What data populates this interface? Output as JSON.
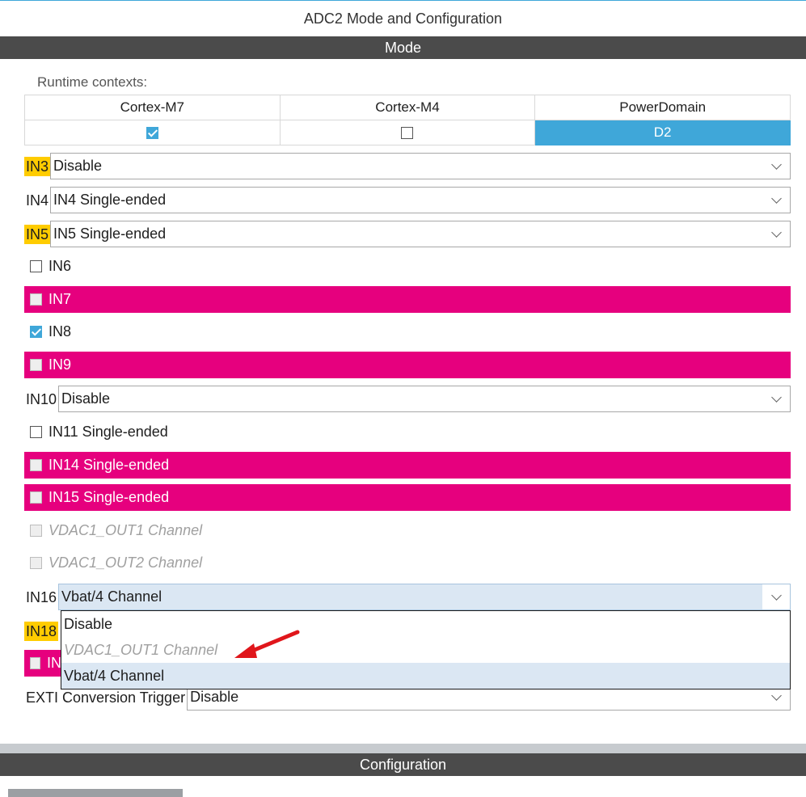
{
  "window": {
    "title": "ADC2 Mode and Configuration"
  },
  "sections": {
    "mode": "Mode",
    "configuration": "Configuration"
  },
  "runtime": {
    "label": "Runtime contexts:",
    "columns": [
      "Cortex-M7",
      "Cortex-M4",
      "PowerDomain"
    ],
    "cortex_m7_checked": true,
    "cortex_m4_checked": false,
    "power_domain": "D2"
  },
  "channels": {
    "in3": {
      "label": "IN3",
      "value": "Disable",
      "highlight": true
    },
    "in4": {
      "label": "IN4",
      "value": "IN4 Single-ended"
    },
    "in5": {
      "label": "IN5",
      "value": "IN5 Single-ended",
      "highlight": true
    },
    "in6": {
      "label": "IN6",
      "checked": false
    },
    "in7": {
      "label": "IN7",
      "checked": false,
      "conflict": true
    },
    "in8": {
      "label": "IN8",
      "checked": true
    },
    "in9": {
      "label": "IN9",
      "checked": false,
      "conflict": true
    },
    "in10": {
      "label": "IN10",
      "value": "Disable"
    },
    "in11": {
      "label": "IN11 Single-ended",
      "checked": false
    },
    "in14": {
      "label": "IN14 Single-ended",
      "checked": false,
      "conflict": true
    },
    "in15": {
      "label": "IN15 Single-ended",
      "checked": false,
      "conflict": true
    },
    "vdac1_out1": {
      "label": "VDAC1_OUT1 Channel",
      "disabled": true
    },
    "vdac1_out2": {
      "label": "VDAC1_OUT2 Channel",
      "disabled": true
    },
    "in16": {
      "label": "IN16",
      "value": "Vbat/4 Channel"
    },
    "in18": {
      "label": "IN18"
    },
    "in19_partial": {
      "label": "IN"
    },
    "exti": {
      "label": "EXTI Conversion Trigger",
      "value": "Disable"
    }
  },
  "dropdown_options": [
    {
      "label": "Disable",
      "state": "normal"
    },
    {
      "label": "VDAC1_OUT1 Channel",
      "state": "disabled"
    },
    {
      "label": "Vbat/4 Channel",
      "state": "selected"
    }
  ],
  "colors": {
    "accent": "#3fa7d9",
    "conflict": "#e6007e",
    "highlight": "#ffcc00",
    "section_bar": "#4b4b4b",
    "annotation_arrow": "#e0161b"
  }
}
